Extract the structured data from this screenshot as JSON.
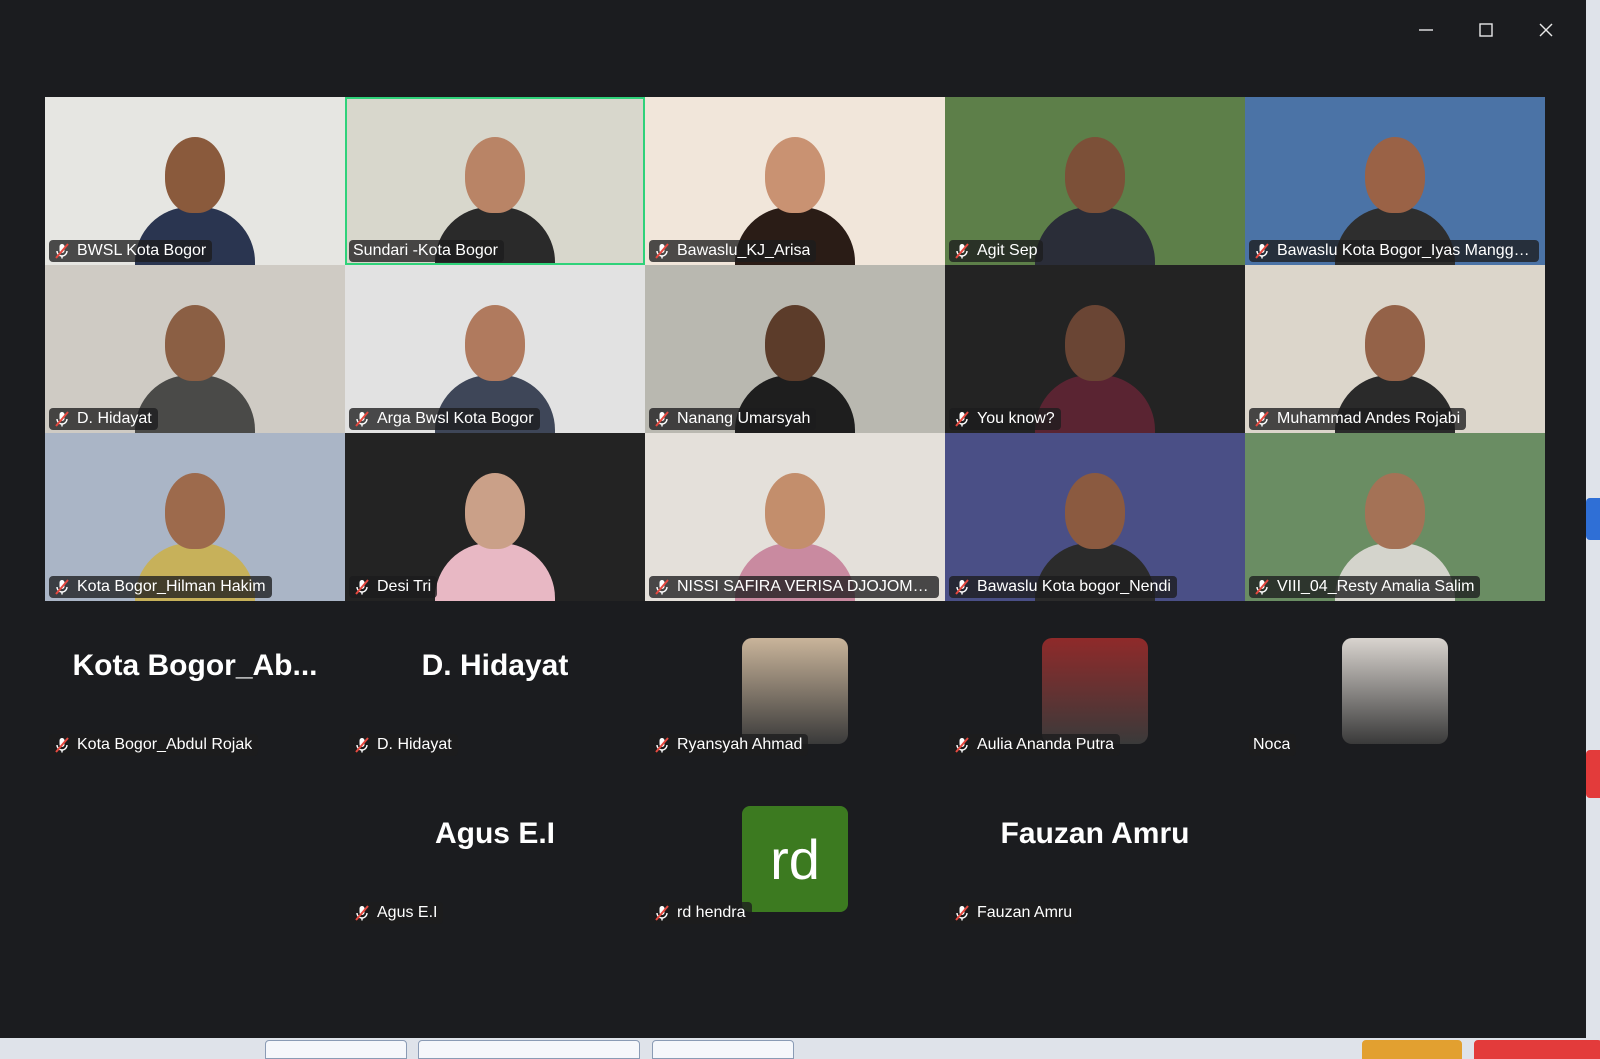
{
  "window": {
    "minimize_label": "minimize",
    "maximize_label": "maximize",
    "close_label": "close"
  },
  "video_tiles": [
    {
      "name": "BWSL Kota Bogor",
      "muted": true,
      "bg": "#e6e6e2",
      "skin": "#8a5a3c",
      "shirt": "#2a3550",
      "active": false
    },
    {
      "name": "Sundari -Kota Bogor",
      "muted": false,
      "bg": "#d8d7cc",
      "skin": "#b98466",
      "shirt": "#2a2a2a",
      "active": true
    },
    {
      "name": "Bawaslu_KJ_Arisa",
      "muted": true,
      "bg": "#f1e6da",
      "skin": "#c99272",
      "shirt": "#2a1c16",
      "active": false
    },
    {
      "name": "Agit Sep",
      "muted": true,
      "bg": "#5d7f49",
      "skin": "#7c5038",
      "shirt": "#2a2d38",
      "active": false
    },
    {
      "name": "Bawaslu Kota Bogor_Iyas Mangga...",
      "muted": true,
      "bg": "#4b73a6",
      "skin": "#9a6246",
      "shirt": "#2e2e2e",
      "active": false
    },
    {
      "name": "D. Hidayat",
      "muted": true,
      "bg": "#cfcbc4",
      "skin": "#8b5f44",
      "shirt": "#4a4a48",
      "active": false
    },
    {
      "name": "Arga Bwsl Kota Bogor",
      "muted": true,
      "bg": "#e2e2e2",
      "skin": "#b07a5e",
      "shirt": "#3e4658",
      "active": false
    },
    {
      "name": "Nanang Umarsyah",
      "muted": true,
      "bg": "#b9b8b0",
      "skin": "#5c3c2a",
      "shirt": "#1e1e1e",
      "active": false
    },
    {
      "name": "You know?",
      "muted": true,
      "bg": "#232323",
      "skin": "#6a4534",
      "shirt": "#5a2432",
      "active": false
    },
    {
      "name": "Muhammad Andes Rojabi",
      "muted": true,
      "bg": "#dcd6cb",
      "skin": "#946248",
      "shirt": "#2a2a2a",
      "active": false
    },
    {
      "name": "Kota Bogor_Hilman Hakim",
      "muted": true,
      "bg": "#aab5c6",
      "skin": "#9d6a4c",
      "shirt": "#c7b15a",
      "active": false
    },
    {
      "name": "Desi Tri",
      "muted": true,
      "bg": "#232323",
      "skin": "#caa088",
      "shirt": "#e8b8c4",
      "active": false
    },
    {
      "name": "NISSI SAFIRA VERISA DJOJOMARD...",
      "muted": true,
      "bg": "#e4e0da",
      "skin": "#c38e6c",
      "shirt": "#c98aa0",
      "active": false
    },
    {
      "name": "Bawaslu Kota bogor_Nendi",
      "muted": true,
      "bg": "#4a4f86",
      "skin": "#8b5a40",
      "shirt": "#2b2b2b",
      "active": false
    },
    {
      "name": "VIII_04_Resty Amalia Salim",
      "muted": true,
      "bg": "#6a8d63",
      "skin": "#a47256",
      "shirt": "#d4d4cc",
      "active": false
    }
  ],
  "name_tiles_row1": [
    {
      "display": "Kota  Bogor_Ab...",
      "name": "Kota Bogor_Abdul Rojak",
      "muted": true,
      "type": "text"
    },
    {
      "display": "D. Hidayat",
      "name": "D. Hidayat",
      "muted": true,
      "type": "text"
    },
    {
      "display": "",
      "name": "Ryansyah Ahmad",
      "muted": true,
      "type": "photo",
      "color": "#c9b49a"
    },
    {
      "display": "",
      "name": "Aulia Ananda Putra",
      "muted": true,
      "type": "photo",
      "color": "#8f2a2a"
    },
    {
      "display": "",
      "name": "Noca",
      "muted": false,
      "type": "photo",
      "color": "#d9d4cf"
    }
  ],
  "name_tiles_row2": [
    {
      "display": "",
      "name": "",
      "muted": false,
      "type": "empty"
    },
    {
      "display": "Agus E.I",
      "name": "Agus E.I",
      "muted": true,
      "type": "text"
    },
    {
      "display": "rd",
      "name": "rd hendra",
      "muted": true,
      "type": "initials"
    },
    {
      "display": "Fauzan Amru",
      "name": "Fauzan Amru",
      "muted": true,
      "type": "text"
    }
  ]
}
